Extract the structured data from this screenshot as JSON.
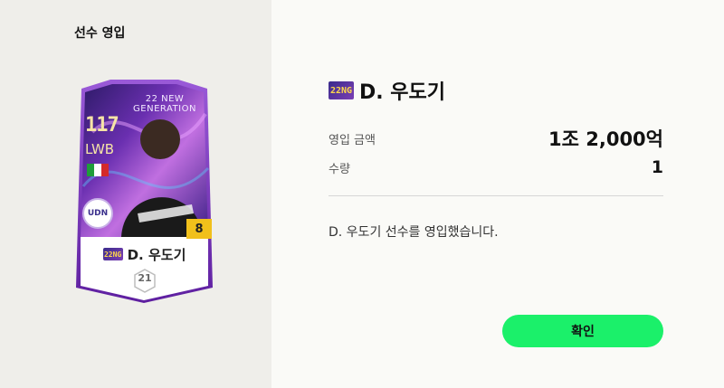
{
  "left_panel": {
    "title": "선수 영입"
  },
  "card": {
    "ovr": "117",
    "position": "LWB",
    "season_line1": "22 NEW",
    "season_line2": "GENERATION",
    "season_badge": "22NG",
    "name": "D. 우도기",
    "enhance_level": "8",
    "grade": "21",
    "club_abbr": "UDN",
    "flag_colors": [
      "#1f9d3a",
      "#ffffff",
      "#d42a2a"
    ],
    "card_colors": {
      "frame": "#7a2fb8",
      "dark": "#2c1a66",
      "light": "#c06fe0"
    }
  },
  "detail": {
    "season_badge": "22NG",
    "player_name": "D. 우도기",
    "price_label": "영입 금액",
    "price_value": "1조 2,000억",
    "quantity_label": "수량",
    "quantity_value": "1",
    "message": "D. 우도기 선수를 영입했습니다."
  },
  "confirm_button": {
    "label": "확인",
    "color": "#1bf06a"
  }
}
